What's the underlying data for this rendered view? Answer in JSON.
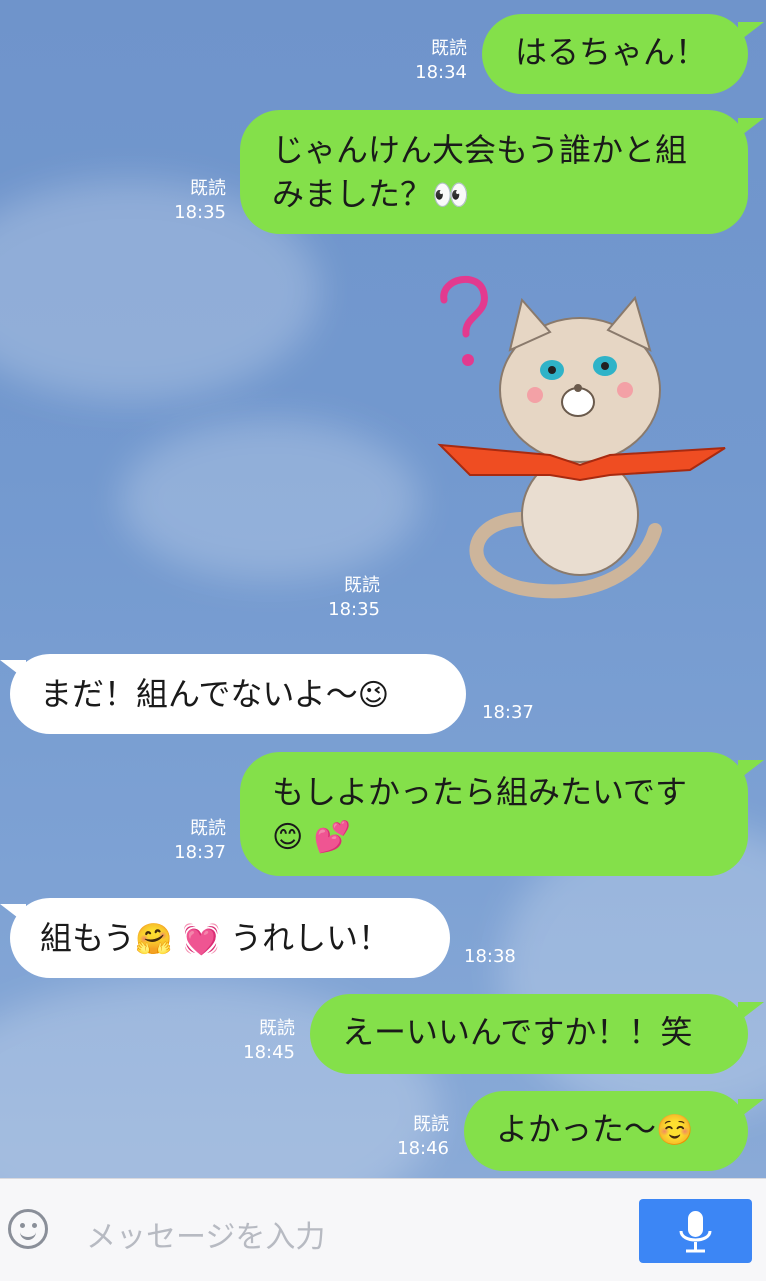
{
  "chat": {
    "messages": [
      {
        "text": "はるちゃん！",
        "read": "既読",
        "time": "18:34"
      },
      {
        "text1": "じゃんけん大会もう誰かと組",
        "text2": "みました？",
        "emoji": "👀",
        "read": "既読",
        "time": "18:35"
      },
      {
        "sticker": "cat-question-sticker",
        "read": "既読",
        "time": "18:35"
      },
      {
        "text": "まだ！組んでないよ〜",
        "emoji": "😉",
        "time": "18:37"
      },
      {
        "text1": "もしよかったら組みたいです",
        "emoji1": "😊",
        "emoji2": "💕",
        "read": "既読",
        "time": "18:37"
      },
      {
        "text_a": "組もう",
        "emoji1": "🤗",
        "emoji2": "💓",
        "text_b": "うれしい！",
        "time": "18:38"
      },
      {
        "text": "えーいいんですか！！笑",
        "read": "既読",
        "time": "18:45"
      },
      {
        "text": "よかった〜",
        "emoji": "☺️",
        "read": "既読",
        "time": "18:46"
      }
    ]
  },
  "input": {
    "placeholder": "メッセージを入力",
    "emoji_icon": "smiley-icon",
    "mic_icon": "microphone-icon"
  },
  "colors": {
    "outgoing_bubble": "#84e04a",
    "incoming_bubble": "#ffffff",
    "mic_button": "#3c86f5"
  }
}
